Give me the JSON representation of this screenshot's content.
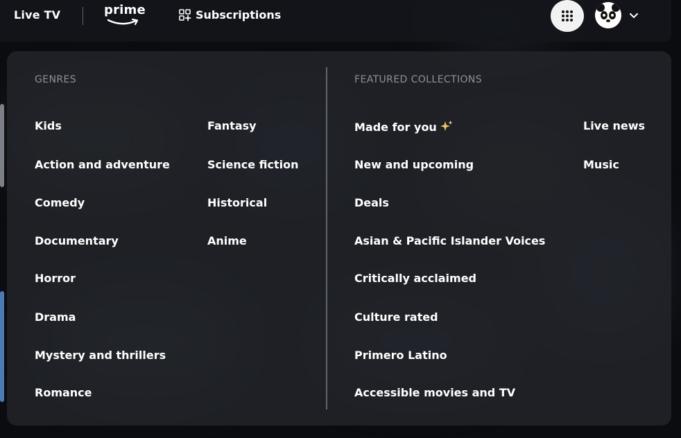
{
  "nav": {
    "live_tv": "Live TV",
    "prime_logo_text": "prime",
    "subscriptions": "Subscriptions",
    "apps_icon": "grid-dots-icon",
    "avatar_icon": "panda-avatar",
    "menu_chevron_icon": "chevron-down-icon"
  },
  "menu": {
    "genres": {
      "heading": "GENRES",
      "items": [
        "Kids",
        "Action and adventure",
        "Comedy",
        "Documentary",
        "Horror",
        "Drama",
        "Mystery and thrillers",
        "Romance",
        "Fantasy",
        "Science fiction",
        "Historical",
        "Anime"
      ]
    },
    "featured": {
      "heading": "FEATURED COLLECTIONS",
      "items": [
        "Made for you",
        "New and upcoming",
        "Deals",
        "Asian & Pacific Islander Voices",
        "Critically acclaimed",
        "Culture rated",
        "Primero Latino",
        "Accessible movies and TV",
        "Live news",
        "Music"
      ],
      "made_for_you_icon": "sparkle-icon"
    }
  },
  "colors": {
    "panel_bg": "#22242a",
    "heading_text": "#8d9199",
    "link_text": "#ffffff",
    "sparkle": "#f5c56b"
  }
}
